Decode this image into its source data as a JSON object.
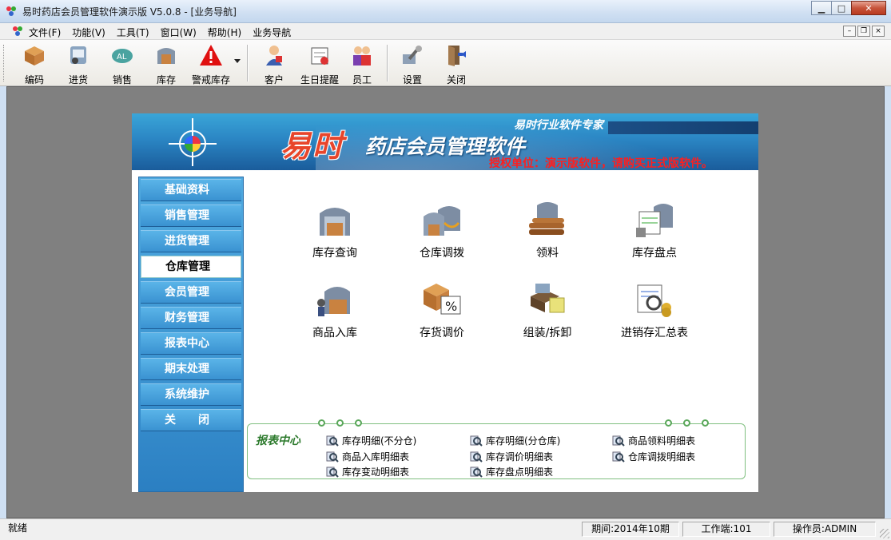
{
  "window": {
    "title": "易时药店会员管理软件演示版 V5.0.8 - [业务导航]",
    "min_label": "▁",
    "max_label": "□",
    "close_label": "✕"
  },
  "menubar": {
    "items": [
      "文件(F)",
      "功能(V)",
      "工具(T)",
      "窗口(W)",
      "帮助(H)",
      "业务导航"
    ]
  },
  "toolbar": {
    "buttons": [
      "编码",
      "进货",
      "销售",
      "库存",
      "警戒库存",
      "客户",
      "生日提醒",
      "员工",
      "设置",
      "关闭"
    ]
  },
  "banner": {
    "brand": "易时",
    "product": "药店会员管理软件",
    "expert": "易时行业软件专家",
    "license": "授权单位：演示版软件，请购买正式版软件。"
  },
  "sidebar": {
    "items": [
      "基础资料",
      "销售管理",
      "进货管理",
      "仓库管理",
      "会员管理",
      "财务管理",
      "报表中心",
      "期末处理",
      "系统维护",
      "关　　闭"
    ],
    "active_index": 3
  },
  "features": [
    "库存查询",
    "仓库调拨",
    "领料",
    "库存盘点",
    "商品入库",
    "存货调价",
    "组装/拆卸",
    "进销存汇总表"
  ],
  "report": {
    "title": "报表中心",
    "links": [
      "库存明细(不分仓)",
      "库存明细(分仓库)",
      "商品领料明细表",
      "商品入库明细表",
      "库存调价明细表",
      "仓库调拨明细表",
      "库存变动明细表",
      "库存盘点明细表"
    ]
  },
  "statusbar": {
    "status": "就绪",
    "period": "期间:2014年10期",
    "workstation": "工作端:101",
    "operator": "操作员:ADMIN"
  },
  "colors": {
    "sidebar": "#3d95d2",
    "license_text": "#ff1e1e",
    "brand_text": "#e8452b",
    "report_title": "#2e7b2e"
  }
}
